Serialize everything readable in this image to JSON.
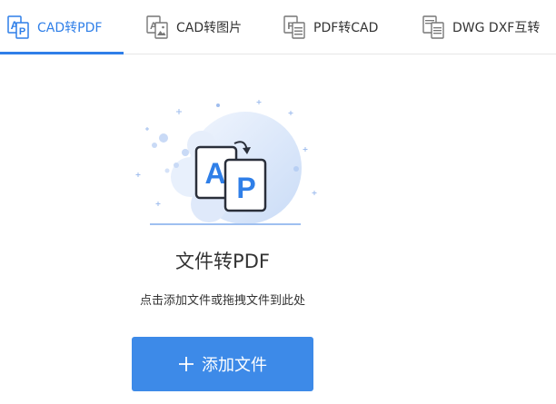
{
  "tabs": [
    {
      "label": "CAD转PDF",
      "icon": "cad-to-pdf-icon",
      "active": true
    },
    {
      "label": "CAD转图片",
      "icon": "cad-to-image-icon",
      "active": false
    },
    {
      "label": "PDF转CAD",
      "icon": "pdf-to-cad-icon",
      "active": false
    },
    {
      "label": "DWG DXF互转",
      "icon": "dwg-dxf-convert-icon",
      "active": false
    }
  ],
  "main": {
    "title": "文件转PDF",
    "hint": "点击添加文件或拖拽文件到此处",
    "add_button_label": "添加文件",
    "illustration_letters": {
      "front": "A",
      "back": "P"
    }
  },
  "colors": {
    "accent": "#2f7fe8",
    "button": "#3d8ae8",
    "blob": "#dde9fb"
  }
}
